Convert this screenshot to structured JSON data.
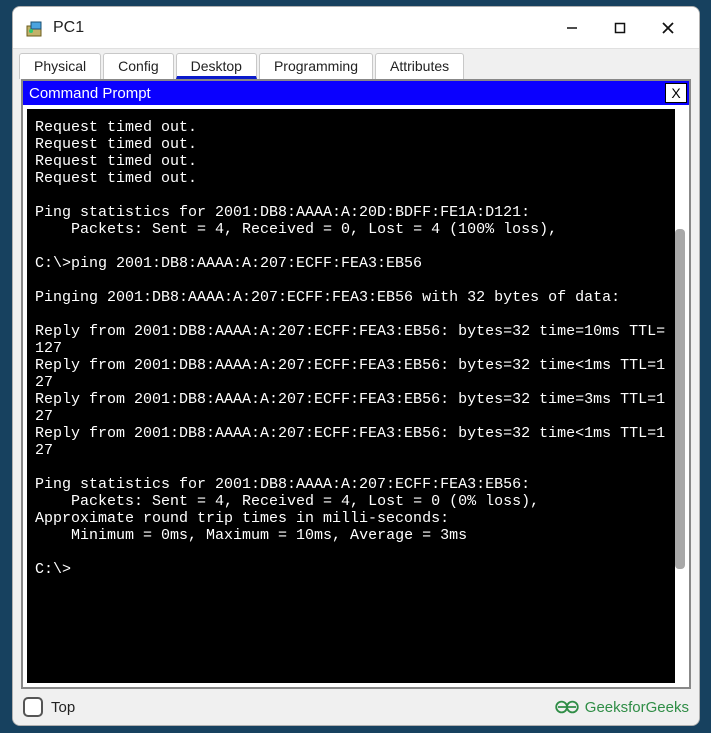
{
  "window": {
    "title": "PC1"
  },
  "tabs": [
    "Physical",
    "Config",
    "Desktop",
    "Programming",
    "Attributes"
  ],
  "activeTabIndex": 2,
  "cmd": {
    "title": "Command Prompt",
    "close": "X"
  },
  "terminal": {
    "lines": [
      "Request timed out.",
      "Request timed out.",
      "Request timed out.",
      "Request timed out.",
      "",
      "Ping statistics for 2001:DB8:AAAA:A:20D:BDFF:FE1A:D121:",
      "    Packets: Sent = 4, Received = 0, Lost = 4 (100% loss),",
      "",
      "C:\\>ping 2001:DB8:AAAA:A:207:ECFF:FEA3:EB56",
      "",
      "Pinging 2001:DB8:AAAA:A:207:ECFF:FEA3:EB56 with 32 bytes of data:",
      "",
      "Reply from 2001:DB8:AAAA:A:207:ECFF:FEA3:EB56: bytes=32 time=10ms TTL=127",
      "Reply from 2001:DB8:AAAA:A:207:ECFF:FEA3:EB56: bytes=32 time<1ms TTL=127",
      "Reply from 2001:DB8:AAAA:A:207:ECFF:FEA3:EB56: bytes=32 time=3ms TTL=127",
      "Reply from 2001:DB8:AAAA:A:207:ECFF:FEA3:EB56: bytes=32 time<1ms TTL=127",
      "",
      "Ping statistics for 2001:DB8:AAAA:A:207:ECFF:FEA3:EB56:",
      "    Packets: Sent = 4, Received = 4, Lost = 0 (0% loss),",
      "Approximate round trip times in milli-seconds:",
      "    Minimum = 0ms, Maximum = 10ms, Average = 3ms",
      "",
      "C:\\>"
    ]
  },
  "bottom": {
    "checkbox_label": "Top",
    "watermark": "GeeksforGeeks"
  }
}
